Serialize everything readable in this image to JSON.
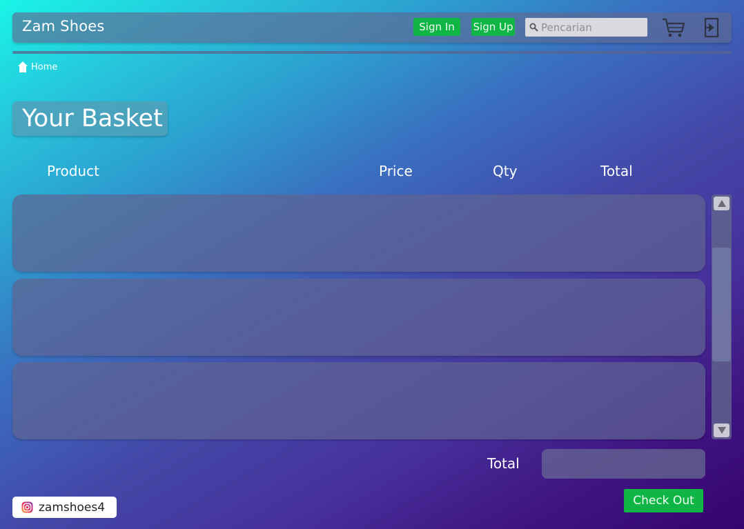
{
  "header": {
    "brand": "Zam Shoes",
    "signin_label": "Sign In",
    "signup_label": "Sign Up",
    "search_placeholder": "Pencarian",
    "search_icon": "search-icon",
    "cart_icon": "cart-icon",
    "exit_icon": "logout-icon"
  },
  "breadcrumb": {
    "icon": "home-icon",
    "label": "Home"
  },
  "page": {
    "title": "Your Basket"
  },
  "table": {
    "columns": [
      "Product",
      "Price",
      "Qty",
      "Total"
    ],
    "rows": [
      {},
      {},
      {}
    ]
  },
  "summary": {
    "total_label": "Total",
    "total_value": "",
    "checkout_label": "Check Out"
  },
  "footer": {
    "social_icon": "instagram-icon",
    "handle": "zamshoes4"
  },
  "colors": {
    "accent_green": "#0fb545",
    "gradient_start": "#19f5e6",
    "gradient_end": "#36046c"
  }
}
